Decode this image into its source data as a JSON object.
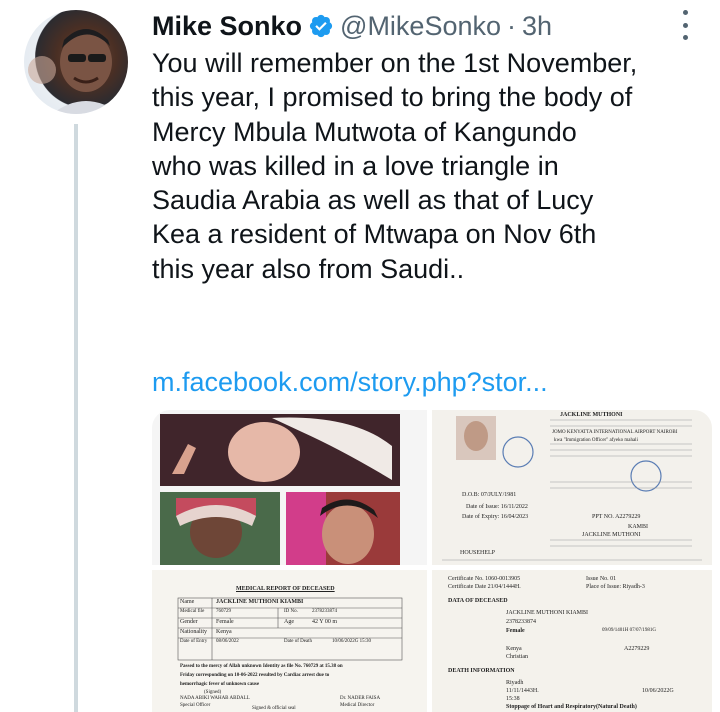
{
  "tweet": {
    "display_name": "Mike Sonko",
    "handle": "@MikeSonko",
    "separator": "·",
    "timestamp": "3h",
    "text_lines": [
      "You will remember on the 1st November,",
      "this year, I promised to bring the body of",
      "Mercy Mbula Mutwota of Kangundo",
      "who was killed in a love triangle in",
      "Saudia Arabia as well as that of Lucy",
      "Kea a resident of Mtwapa on Nov 6th",
      "this year also from Saudi.."
    ],
    "link": "m.facebook.com/story.php?stor...",
    "icons": {
      "verified": "verified-badge-icon",
      "more": "more-options-icon"
    },
    "colors": {
      "link": "#1d9bf0",
      "verified": "#1d9bf0",
      "secondary": "#536471",
      "thread": "#cfd9de"
    }
  },
  "media": {
    "passport": {
      "header": "JACKLINE MUTHONI",
      "immigration_lines": [
        "JOMO KENYATTA INTERNATIONAL AIRPORT NAIROBI",
        "kwa \"Immigration Officer\" afyeko mahali"
      ],
      "dob": "D.O.B: 07/JULY/1981",
      "issue": "Date of Issue: 16/11/2022",
      "expiry": "Date of Expiry: 16/04/2023",
      "place": "KAMBI",
      "holder": "JACKLINE MUTHONI",
      "occupation": "HOUSEHELP",
      "ppt": "PPT NO. A2279229"
    },
    "medical_report": {
      "title": "MEDICAL REPORT OF DECEASED",
      "rows": [
        [
          "Name",
          "JACKLINE MUTHONI KIAMBI"
        ],
        [
          "Medical file",
          "760729",
          "ID No.",
          "2378233874"
        ],
        [
          "Gender",
          "Female",
          "Age",
          "42 Y 00 m"
        ],
        [
          "Nationality",
          "Kenya"
        ],
        [
          "Date of Entry",
          "08/06/2022",
          "Date of Death",
          "10/06/2022G 15:30"
        ]
      ],
      "body_lines": [
        "Passed to the mercy of Allah unknown Identity as file No. 760729 at 15.38 on",
        "Friday corresponding on 10-06-2022 resulted by Cardiac arrest due to",
        "hemorrhagic fever of unknown cause"
      ],
      "signed": "(Signed)",
      "signatory_left": "NADA ABIKI WAHAB ABDALL",
      "role_left": "Special Officer",
      "signatory_right": "Dr. NADER FAISA",
      "role_right": "Medical Director",
      "footer": "Signed & official seal"
    },
    "death_certificate": {
      "cert_no": "Certificate No. 1060-0013905",
      "issue_no": "Issue No. 01",
      "cert_date": "Certificate Date 21/04/1444H.",
      "place_issue": "Place of Issue: Riyadh-3",
      "section_deceased": "DATA OF DECEASED",
      "name": "JACKLINE MUTHONI KIAMBI",
      "reg_no": "2378233874",
      "sex": "Female",
      "dob": "09/09/1401H 07/07/1981G",
      "nationality": "Kenya",
      "religion": "Christian",
      "passport": "A2279229",
      "section_death": "DEATH INFORMATION",
      "place_of_death": "Riyadh",
      "date_of_death": "11/11/1443H.",
      "corresponding": "10/06/2022G",
      "time": "15:38",
      "cause": "Stoppage of Heart and Respiratory(Natural Death)"
    }
  }
}
